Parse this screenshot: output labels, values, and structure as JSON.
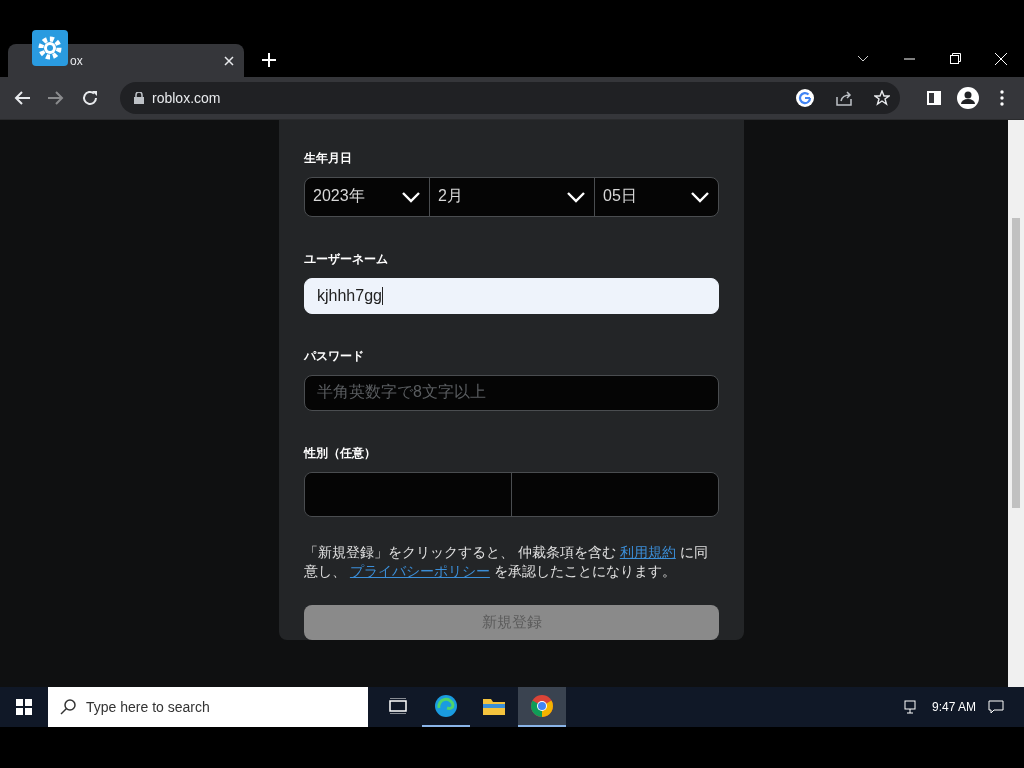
{
  "browser": {
    "tab": {
      "title": "ox"
    },
    "url": "roblox.com"
  },
  "form": {
    "birthday": {
      "label": "生年月日",
      "selects": [
        {
          "value": "2023年"
        },
        {
          "value": "2月"
        },
        {
          "value": "05日"
        }
      ]
    },
    "username": {
      "label": "ユーザーネーム",
      "value": "kjhhh7gg",
      "focused": true
    },
    "password": {
      "label": "パスワード",
      "placeholder": "半角英数字で8文字以上"
    },
    "gender": {
      "label": "性別（任意）",
      "options": [
        {
          "selected": false
        },
        {
          "selected": false
        }
      ]
    },
    "terms": [
      {
        "text": "「新規登録」をクリックすると、 仲裁条項を含む ",
        "link": false
      },
      {
        "text": "利用規約",
        "link": true
      },
      {
        "text": " に同意し、 ",
        "link": false
      },
      {
        "text": "プライバシーポリシー",
        "link": true
      },
      {
        "text": " を承認したことになります。",
        "link": false
      }
    ],
    "submit": {
      "label": "新規登録",
      "disabled": true
    }
  },
  "taskbar": {
    "search_placeholder": "Type here to search",
    "apps": [
      {
        "kind": "taskview",
        "selected": false
      },
      {
        "kind": "edge",
        "selected": false
      },
      {
        "kind": "folder",
        "selected": false
      },
      {
        "kind": "chrome",
        "selected": true
      }
    ],
    "clock": "9:47 AM"
  }
}
